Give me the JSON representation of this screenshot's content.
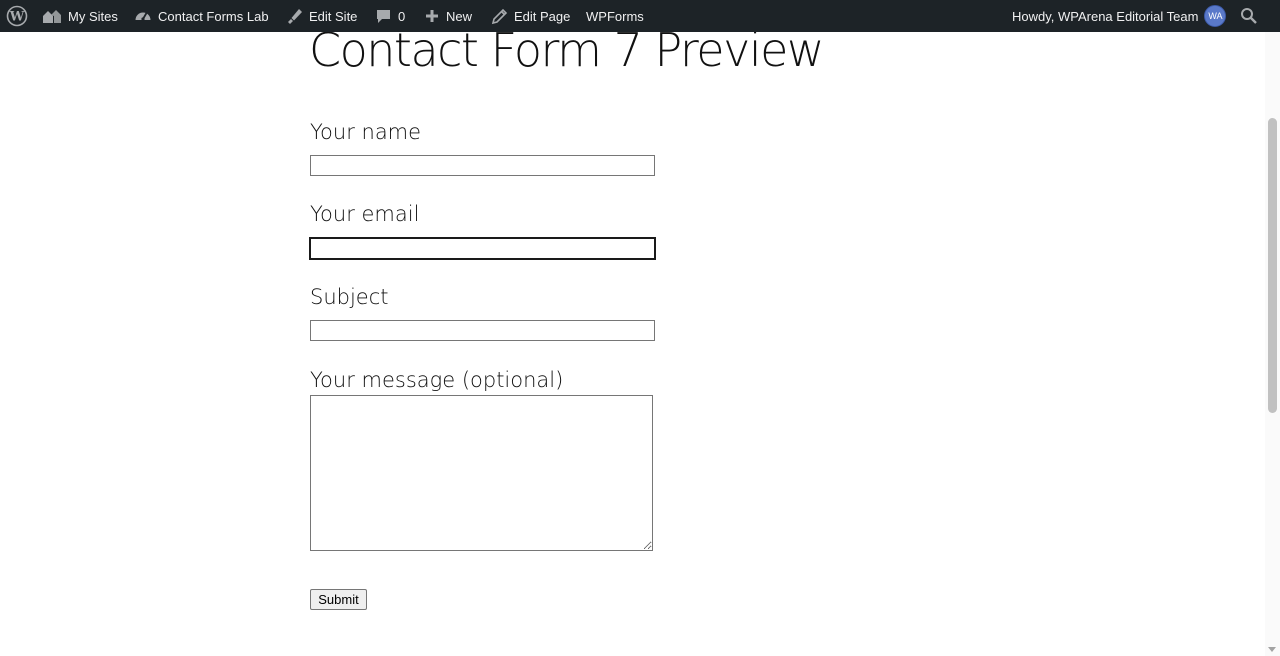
{
  "admin_bar": {
    "wp_logo_icon": "wordpress-logo-icon",
    "my_sites": "My Sites",
    "site_name": "Contact Forms Lab",
    "edit_site": "Edit Site",
    "comments_count": "0",
    "new": "New",
    "edit_page": "Edit Page",
    "wpforms": "WPForms",
    "howdy": "Howdy, WPArena Editorial Team",
    "avatar_initials": "WA",
    "background_color": "#1d2327"
  },
  "page": {
    "title": "Contact Form 7 Preview"
  },
  "form": {
    "name_label": "Your name",
    "name_value": "",
    "email_label": "Your email",
    "email_value": "",
    "subject_label": "Subject",
    "subject_value": "",
    "message_label": "Your message (optional)",
    "message_value": "",
    "submit_label": "Submit"
  }
}
